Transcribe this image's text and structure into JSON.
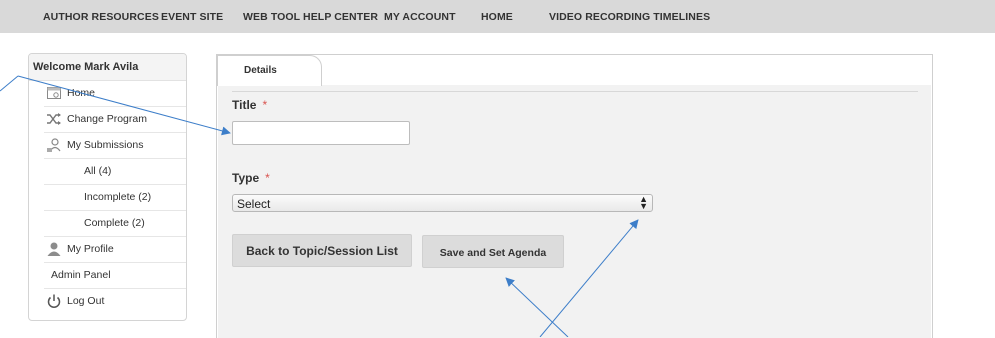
{
  "topnav": {
    "items": [
      "AUTHOR RESOURCES",
      "EVENT SITE",
      "WEB TOOL HELP CENTER",
      "MY ACCOUNT",
      "HOME",
      "VIDEO RECORDING TIMELINES"
    ]
  },
  "sidebar": {
    "welcome": "Welcome Mark Avila",
    "items": [
      {
        "label": "Home",
        "icon": "home-icon"
      },
      {
        "label": "Change Program",
        "icon": "shuffle-icon"
      },
      {
        "label": "My Submissions",
        "icon": "submissions-icon"
      },
      {
        "label": "All (4)"
      },
      {
        "label": "Incomplete (2)"
      },
      {
        "label": "Complete (2)"
      },
      {
        "label": "My Profile",
        "icon": "user-icon"
      },
      {
        "label": "Admin Panel"
      },
      {
        "label": "Log Out",
        "icon": "power-icon"
      }
    ]
  },
  "tabs": {
    "details": "Details"
  },
  "form": {
    "title_label": "Title",
    "type_label": "Type",
    "required_marker": "*",
    "title_value": "",
    "type_selected": "Select",
    "back_button": "Back to Topic/Session List",
    "save_button": "Save and Set Agenda"
  },
  "colors": {
    "nav_bg": "#d9d9d9",
    "panel_bg": "#f2f2f2",
    "button_bg": "#dcdcdc",
    "required": "#d9534f",
    "annotation_arrow": "#3d7ec9"
  }
}
